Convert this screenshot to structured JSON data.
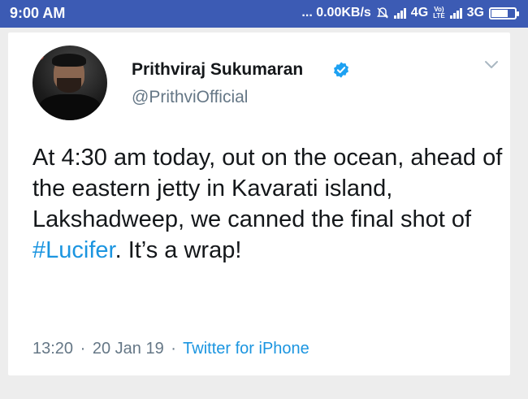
{
  "status_bar": {
    "time": "9:00 AM",
    "network_speed": "... 0.00KB/s",
    "network_4g": "4G",
    "volte_label_top": "Vo)",
    "volte_label_bottom": "LTE",
    "network_3g": "3G",
    "battery_icon": "battery-icon"
  },
  "tweet": {
    "author_name": "Prithviraj Sukumaran",
    "author_handle": "@PrithviOfficial",
    "verified": true,
    "text_before_hashtag": "At 4:30 am today, out on the ocean, ahead of the eastern jetty in Kavarati island, Lakshadweep, we canned the final shot of ",
    "hashtag": "#Lucifer",
    "text_after_hashtag": ". It’s a wrap!",
    "time": "13:20",
    "date": "20 Jan 19",
    "separator": "·",
    "source": "Twitter for iPhone"
  },
  "colors": {
    "status_bar": "#3c5bb4",
    "link": "#1b95e0",
    "verified": "#1da1f2",
    "secondary_text": "#657786"
  }
}
